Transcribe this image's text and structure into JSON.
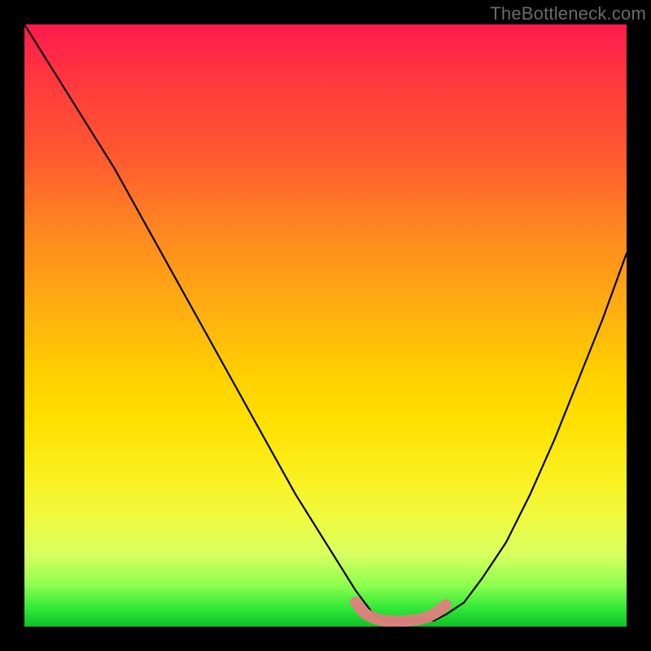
{
  "watermark": "TheBottleneck.com",
  "chart_data": {
    "type": "line",
    "title": "",
    "xlabel": "",
    "ylabel": "",
    "xlim": [
      0,
      100
    ],
    "ylim": [
      0,
      100
    ],
    "grid": false,
    "legend": false,
    "series": [
      {
        "name": "curve",
        "color": "#000000",
        "x": [
          0,
          5,
          10,
          15,
          20,
          25,
          30,
          35,
          40,
          45,
          50,
          55,
          58,
          60,
          62,
          65,
          68,
          70,
          73,
          76,
          80,
          84,
          88,
          92,
          96,
          100
        ],
        "y": [
          100,
          92,
          84,
          76,
          67,
          58,
          49,
          40,
          31,
          22,
          14,
          6,
          2,
          1,
          1,
          1,
          1,
          2,
          4,
          8,
          14,
          22,
          31,
          41,
          51,
          62
        ]
      },
      {
        "name": "valley-marker",
        "color": "#e08080",
        "x": [
          55,
          56.5,
          58,
          59.5,
          61,
          62.5,
          64,
          65.5,
          67,
          68.5,
          70
        ],
        "y": [
          4,
          2.2,
          1.4,
          1.0,
          0.9,
          0.9,
          1.0,
          1.2,
          1.6,
          2.4,
          3.6
        ]
      }
    ],
    "background_gradient": {
      "top": "#ff1a4d",
      "mid": "#ffe000",
      "bottom": "#10c028"
    }
  }
}
